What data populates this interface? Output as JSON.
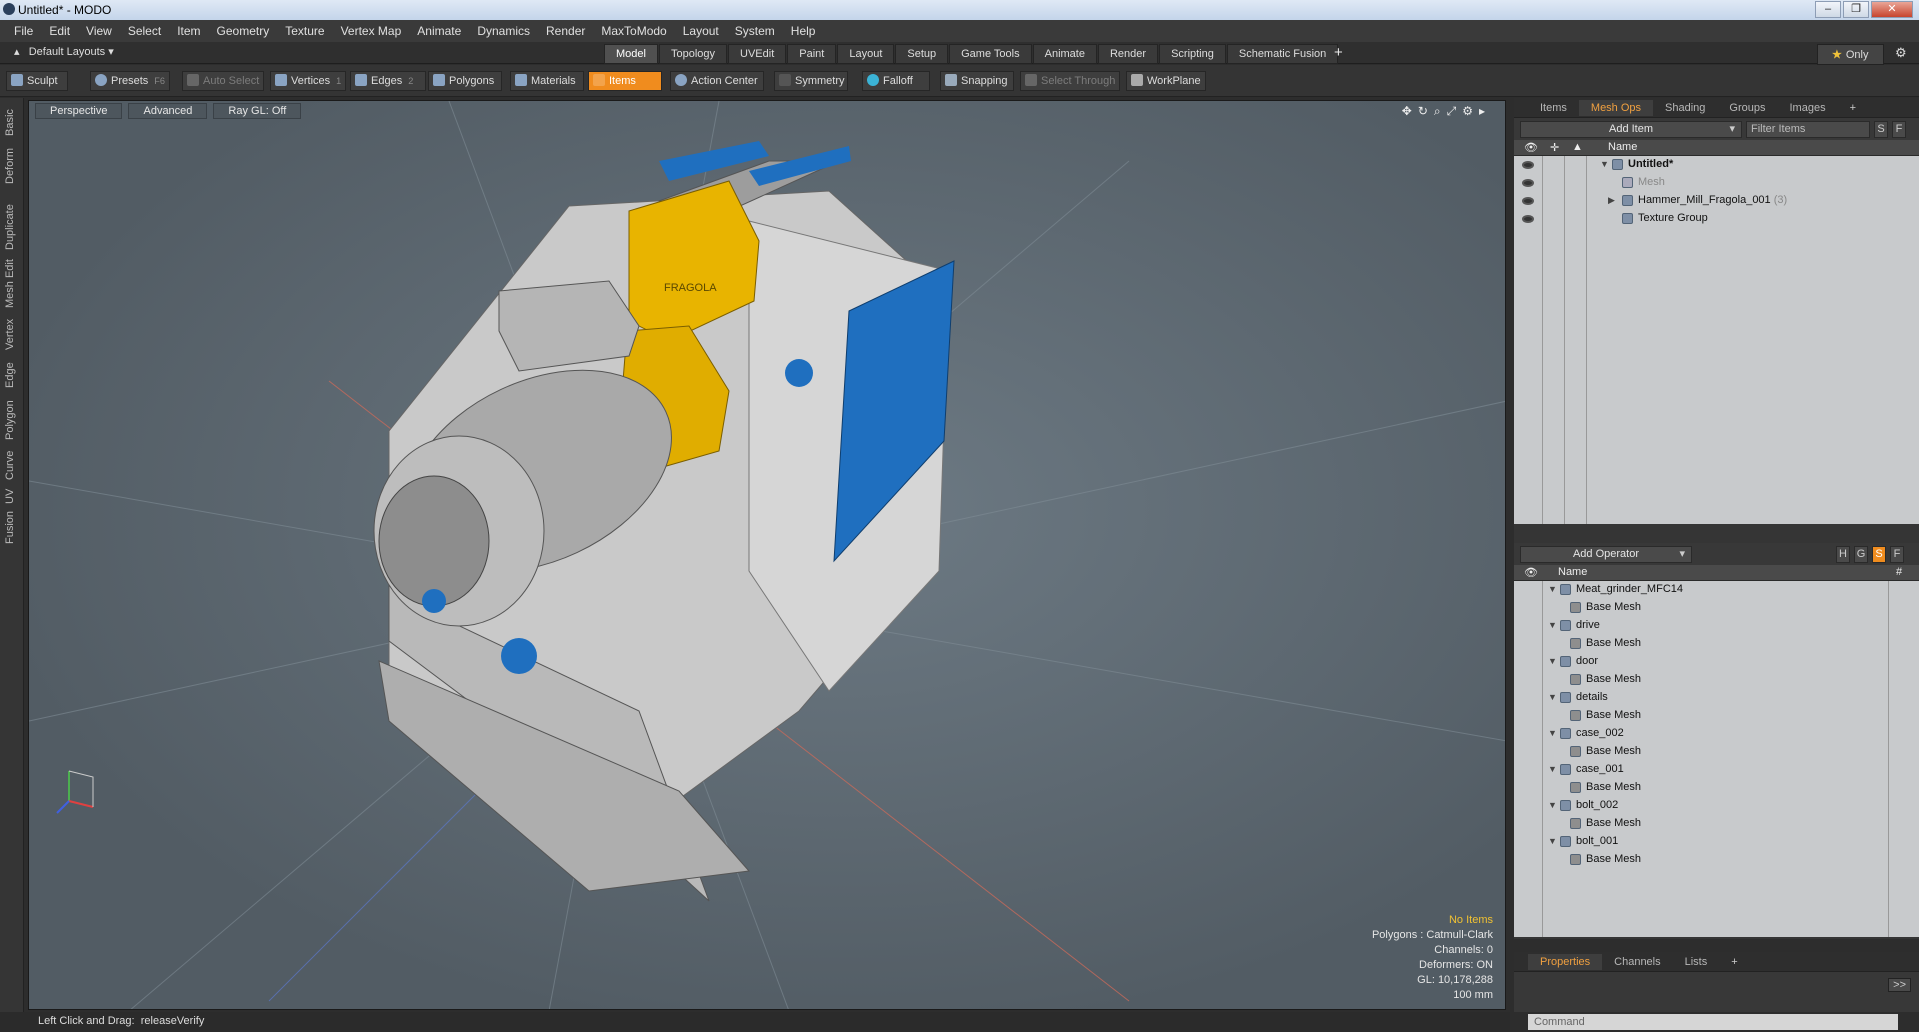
{
  "window": {
    "title": "Untitled* - MODO",
    "buttons": [
      "–",
      "❐",
      "✕"
    ]
  },
  "menu": [
    "File",
    "Edit",
    "View",
    "Select",
    "Item",
    "Geometry",
    "Texture",
    "Vertex Map",
    "Animate",
    "Dynamics",
    "Render",
    "MaxToModo",
    "Layout",
    "System",
    "Help"
  ],
  "layout_selector": "Default Layouts",
  "layout_tabs": [
    "Model",
    "Topology",
    "UVEdit",
    "Paint",
    "Layout",
    "Setup",
    "Game Tools",
    "Animate",
    "Render",
    "Scripting",
    "Schematic Fusion"
  ],
  "active_tab": "Model",
  "only_label": "Only",
  "toolbar": {
    "sculpt": "Sculpt",
    "presets": "Presets",
    "presets_key": "F6",
    "auto_select": "Auto Select",
    "vertices": "Vertices",
    "vertices_key": "1",
    "edges": "Edges",
    "edges_key": "2",
    "polygons": "Polygons",
    "materials": "Materials",
    "items": "Items",
    "action_center": "Action Center",
    "symmetry": "Symmetry",
    "falloff": "Falloff",
    "snapping": "Snapping",
    "select_through": "Select Through",
    "workplane": "WorkPlane"
  },
  "left_strip": [
    "Basic",
    "Deform",
    "Duplicate",
    "Mesh Edit",
    "Vertex",
    "Edge",
    "Polygon",
    "Curve",
    "UV",
    "Fusion"
  ],
  "viewport": {
    "view": "Perspective",
    "shading": "Advanced",
    "raygl": "Ray GL: Off",
    "stats": {
      "selection": "No Items",
      "polygons": "Polygons : Catmull-Clark",
      "channels": "Channels: 0",
      "deformers": "Deformers: ON",
      "gl": "GL: 10,178,288",
      "scale": "100 mm"
    },
    "logo_text": "FRAGOLA"
  },
  "status": {
    "hint": "Left Click and Drag:",
    "action": "releaseVerify"
  },
  "items_panel": {
    "tabs": [
      "Items",
      "Mesh Ops",
      "Shading",
      "Groups",
      "Images"
    ],
    "active": "Mesh Ops",
    "add_item": "Add Item",
    "filter": "Filter Items",
    "s": "S",
    "f": "F",
    "col_name": "Name",
    "rows": [
      {
        "label": "Untitled*",
        "count": ""
      },
      {
        "label": "Mesh",
        "count": ""
      },
      {
        "label": "Hammer_Mill_Fragola_001",
        "count": "(3)"
      },
      {
        "label": "Texture Group",
        "count": ""
      }
    ]
  },
  "meshops_panel": {
    "add_operator": "Add Operator",
    "h": "H",
    "g": "G",
    "s": "S",
    "f": "F",
    "col_name": "Name",
    "col_hash": "#",
    "groups": [
      {
        "name": "Meat_grinder_MFC14",
        "child": "Base Mesh"
      },
      {
        "name": "drive",
        "child": "Base Mesh"
      },
      {
        "name": "door",
        "child": "Base Mesh"
      },
      {
        "name": "details",
        "child": "Base Mesh"
      },
      {
        "name": "case_002",
        "child": "Base Mesh"
      },
      {
        "name": "case_001",
        "child": "Base Mesh"
      },
      {
        "name": "bolt_002",
        "child": "Base Mesh"
      },
      {
        "name": "bolt_001",
        "child": "Base Mesh"
      }
    ]
  },
  "props_panel": {
    "tabs": [
      "Properties",
      "Channels",
      "Lists"
    ],
    "active": "Properties",
    "expand": ">>"
  },
  "command": {
    "placeholder": "Command"
  },
  "colors": {
    "accent": "#f08c1e",
    "viewport": "#5f6b74",
    "yellow": "#e8b400",
    "blue": "#1f6fbf"
  }
}
